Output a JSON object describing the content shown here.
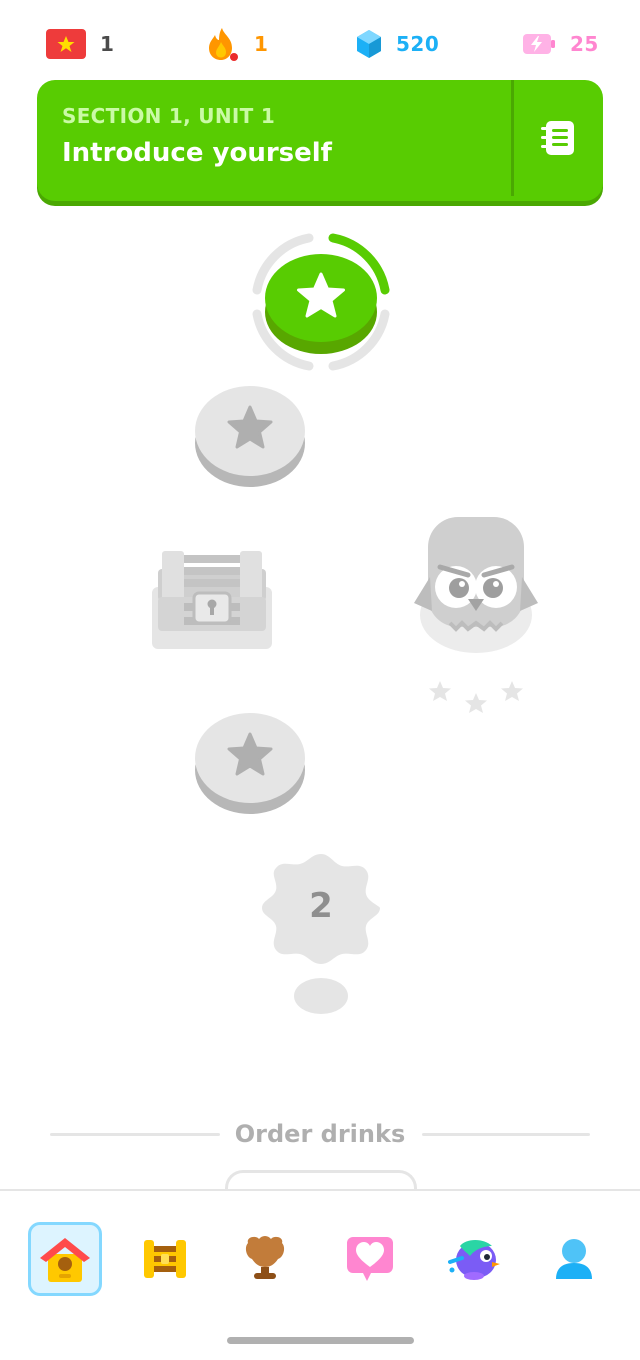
{
  "stats": {
    "course_flag": {
      "icon": "course-flag-icon",
      "value": "1",
      "color": "#4b4b4b"
    },
    "streak": {
      "icon": "flame-icon",
      "value": "1",
      "color": "#ff9600"
    },
    "gems": {
      "icon": "gem-icon",
      "value": "520",
      "color": "#1cb0f6"
    },
    "energy": {
      "icon": "battery-bolt-icon",
      "value": "25",
      "color": "#ff86d0"
    }
  },
  "unit": {
    "section_label": "SECTION 1, UNIT 1",
    "title": "Introduce yourself",
    "guide_icon": "notebook-icon",
    "color": "#58cc02"
  },
  "path": {
    "nodes": [
      {
        "type": "lesson",
        "state": "active",
        "icon": "star-icon"
      },
      {
        "type": "lesson",
        "state": "locked",
        "icon": "star-icon"
      },
      {
        "type": "chest",
        "state": "locked",
        "icon": "treasure-chest-icon"
      },
      {
        "type": "character",
        "state": "locked",
        "icon": "owl-character-icon"
      },
      {
        "type": "lesson",
        "state": "locked",
        "icon": "star-icon"
      },
      {
        "type": "unit-review",
        "state": "locked",
        "label": "2"
      }
    ]
  },
  "next_unit": {
    "title": "Order drinks"
  },
  "bottom_nav": [
    {
      "id": "learn",
      "icon": "home-icon",
      "active": true
    },
    {
      "id": "practice",
      "icon": "practice-dumbbell-icon",
      "active": false
    },
    {
      "id": "leaderboard",
      "icon": "trophy-icon",
      "active": false
    },
    {
      "id": "friends",
      "icon": "heart-icon",
      "active": false
    },
    {
      "id": "store",
      "icon": "bird-icon",
      "active": false
    },
    {
      "id": "profile",
      "icon": "profile-icon",
      "active": false
    }
  ]
}
